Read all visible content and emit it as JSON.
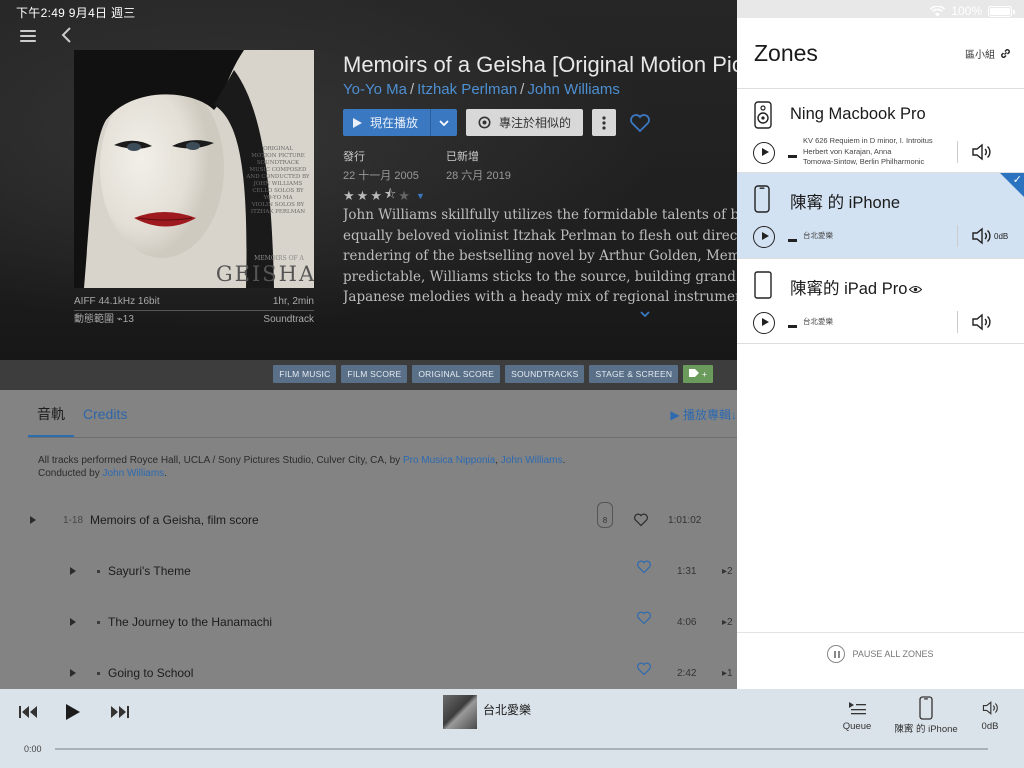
{
  "status": {
    "time_date": "下午2:49   9月4日 週三",
    "battery": "100%",
    "battery_level": 1.0
  },
  "album": {
    "title": "Memoirs of a Geisha [Original Motion Picture Soundtrack]",
    "artists": [
      "Yo-Yo Ma",
      "Itzhak Perlman",
      "John Williams"
    ],
    "play_now_label": "現在播放",
    "focus_label": "專注於相似的",
    "release_label": "發行",
    "release_date": "22 十一月 2005",
    "added_label": "已新增",
    "added_date": "28 六月 2019",
    "rating": 3.5,
    "format": "AIFF 44.1kHz 16bit",
    "duration": "1hr, 2min",
    "dynamic_range": "動態範圍 ⌁13",
    "genre": "Soundtrack",
    "review_lines": [
      "John Williams skillfully utilizes the formidable talents of both",
      "equally beloved violinist Itzhak Perlman to flesh out director",
      "rendering of the bestselling novel by Arthur Golden, Memoirs",
      "predictable, Williams sticks to the source, building grand West",
      "Japanese melodies with a heady mix of regional instruments"
    ],
    "art": {
      "credit_lines": [
        "ORIGINAL",
        "MOTION PICTURE",
        "SOUNDTRACK",
        "",
        "MUSIC COMPOSED",
        "AND CONDUCTED BY",
        "JOHN WILLIAMS",
        "",
        "CELLO SOLOS BY",
        "YO-YO MA",
        "",
        "VIOLIN SOLOS BY",
        "ITZHAK PERLMAN"
      ],
      "word": "GEISHA",
      "prefix": "MEMOIRS OF A"
    }
  },
  "tags": [
    "FILM MUSIC",
    "FILM SCORE",
    "ORIGINAL SCORE",
    "SOUNDTRACKS",
    "STAGE & SCREEN"
  ],
  "tabs": {
    "tracks": "音軌",
    "credits": "Credits",
    "play_album": "▶ 播放專輯↓"
  },
  "credits_text": {
    "pre": "All tracks performed Royce Hall, UCLA / Sony Pictures Studio, Culver City, CA, by ",
    "link1": "Pro Musica Nipponia",
    "mid": ", ",
    "link2": "John Williams",
    "end": ".",
    "line2_pre": "Conducted by ",
    "line2_link": "John Williams",
    "line2_end": "."
  },
  "tracks": [
    {
      "num": "1-18",
      "title": "Memoirs of a Geisha, film score",
      "duration": "1:01:02",
      "badge": "8",
      "extra": ""
    },
    {
      "num": "",
      "title": "Sayuri's Theme",
      "duration": "1:31",
      "badge": "",
      "extra": "▸2"
    },
    {
      "num": "",
      "title": "The Journey to the Hanamachi",
      "duration": "4:06",
      "badge": "",
      "extra": "▸2"
    },
    {
      "num": "",
      "title": "Going to School",
      "duration": "2:42",
      "badge": "",
      "extra": "▸1"
    }
  ],
  "zones": {
    "title": "Zones",
    "group_label": "區小組",
    "items": [
      {
        "name": "Ning Macbook Pro",
        "np_lines": [
          "KV 626 Requiem in D minor, I. Introitus",
          "Herbert von Karajan, Anna",
          "Tomowa-Sintow, Berlin Philharmonic"
        ],
        "db": ""
      },
      {
        "name": "陳寗 的 iPhone",
        "np_lines": [
          "台北愛樂"
        ],
        "db": "0dB"
      },
      {
        "name": "陳寗的 iPad Pro",
        "np_lines": [
          "台北愛樂"
        ],
        "db": ""
      }
    ],
    "pause_all": "PAUSE ALL ZONES"
  },
  "player": {
    "now_playing": "台北愛樂",
    "time": "0:00",
    "queue_label": "Queue",
    "zone_label": "陳寗 的 iPhone",
    "volume_label": "0dB"
  },
  "colors": {
    "accent": "#3a78c2",
    "link": "#4d8fd1",
    "tag": "#5a6f88",
    "selected_zone": "#d3e2f2"
  }
}
